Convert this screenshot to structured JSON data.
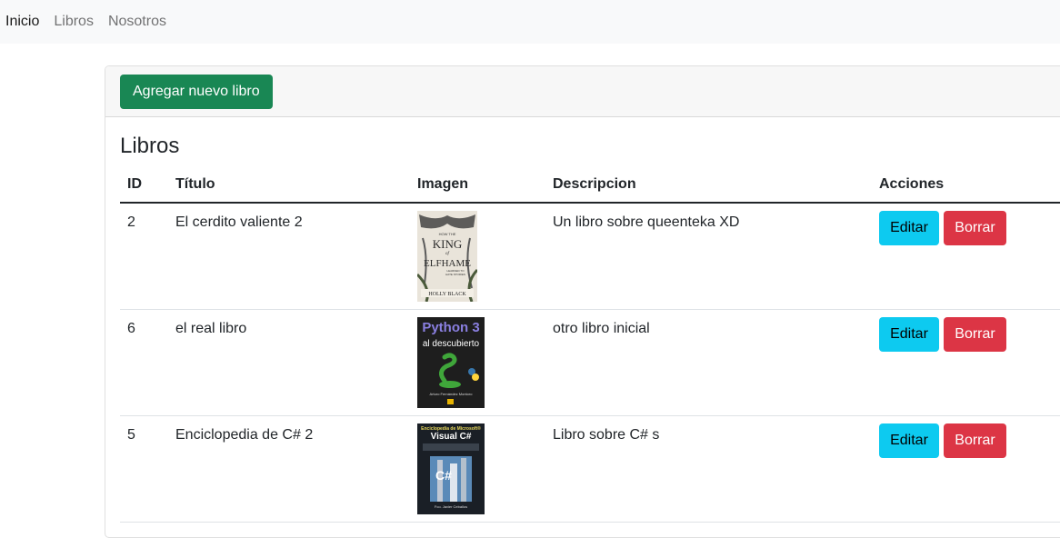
{
  "nav": {
    "items": [
      {
        "label": "Inicio",
        "active": true
      },
      {
        "label": "Libros",
        "active": false
      },
      {
        "label": "Nosotros",
        "active": false
      }
    ]
  },
  "header": {
    "add_button": "Agregar nuevo libro"
  },
  "main": {
    "title": "Libros",
    "columns": [
      "ID",
      "Título",
      "Imagen",
      "Descripcion",
      "Acciones"
    ],
    "rows": [
      {
        "id": "2",
        "title": "El cerdito valiente 2",
        "description": "Un libro sobre queenteka XD",
        "cover": {
          "icon": "book-cover-fantasy",
          "line1": "HOW THE",
          "line2": "KING",
          "line3": "of",
          "line4": "ELFHAME",
          "line5": "LEARNED TO",
          "line6": "HATE STORIES",
          "author": "HOLLY BLACK"
        },
        "edit": "Editar",
        "delete": "Borrar"
      },
      {
        "id": "6",
        "title": "el real libro",
        "description": "otro libro inicial",
        "cover": {
          "icon": "book-cover-python",
          "line1": "Python 3",
          "line2": "al descubierto",
          "author": "Arturo Fernández Montoro"
        },
        "edit": "Editar",
        "delete": "Borrar"
      },
      {
        "id": "5",
        "title": "Enciclopedia de C# 2",
        "description": "Libro sobre C# s",
        "cover": {
          "icon": "book-cover-csharp",
          "line1": "Enciclopedia de Microsoft®",
          "line2": "Visual C#",
          "line3": "C#",
          "author": "Fco. Javier Ceballos"
        },
        "edit": "Editar",
        "delete": "Borrar"
      }
    ]
  },
  "colors": {
    "success": "#198754",
    "info": "#0dcaf0",
    "danger": "#dc3545",
    "navbar_bg": "#f8f9fa"
  }
}
